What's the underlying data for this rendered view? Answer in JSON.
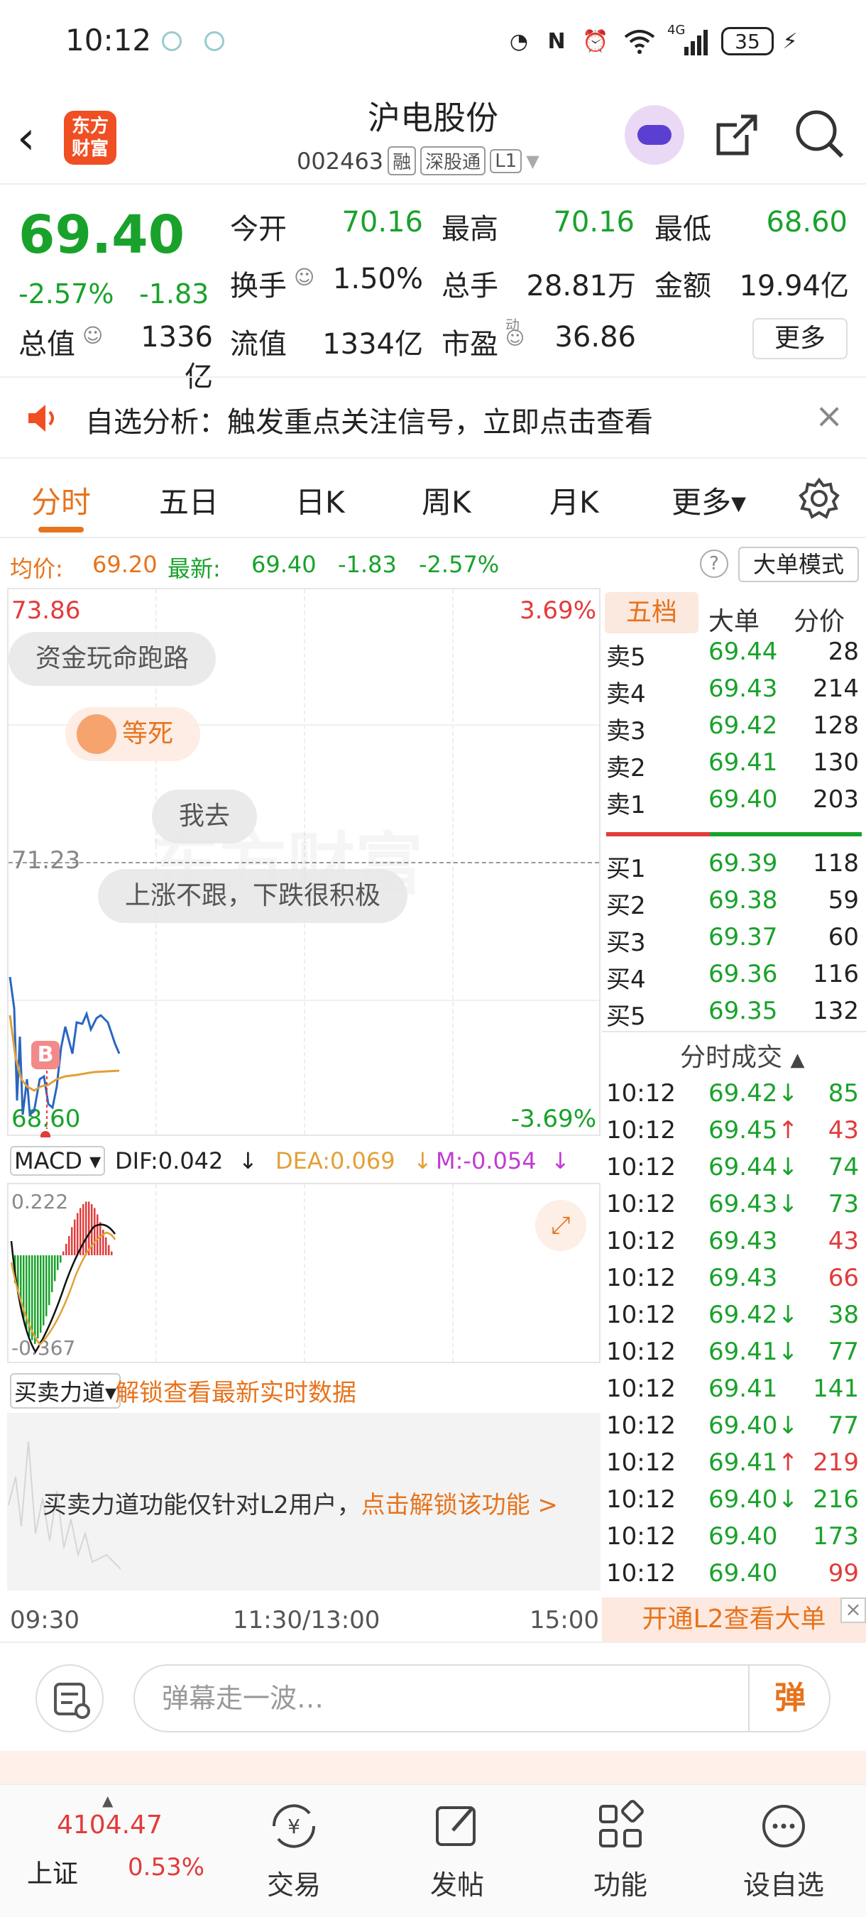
{
  "status": {
    "time": "10:12",
    "network": "4G",
    "battery": "35"
  },
  "header": {
    "logo_line1": "东方",
    "logo_line2": "财富",
    "stock_name": "沪电股份",
    "stock_code": "002463",
    "tags": [
      "融",
      "深股通",
      "L1"
    ]
  },
  "quote": {
    "price": "69.40",
    "change_pct": "-2.57%",
    "change": "-1.83",
    "open_label": "今开",
    "open": "70.16",
    "high_label": "最高",
    "high": "70.16",
    "low_label": "最低",
    "low": "68.60",
    "turnover_label": "换手",
    "turnover": "1.50%",
    "volume_label": "总手",
    "volume": "28.81万",
    "amount_label": "金额",
    "amount": "19.94亿",
    "mcap_label": "总值",
    "mcap": "1336亿",
    "float_label": "流值",
    "float": "1334亿",
    "pe_label": "市盈",
    "pe_super": "动",
    "pe": "36.86",
    "more_label": "更多"
  },
  "alert": {
    "text": "自选分析：触发重点关注信号，立即点击查看"
  },
  "tabs": [
    "分时",
    "五日",
    "日K",
    "周K",
    "月K",
    "更多▾"
  ],
  "avgbar": {
    "avg_label": "均价:",
    "avg": "69.20",
    "latest_label": "最新:",
    "latest": "69.40",
    "chg": "-1.83",
    "pct": "-2.57%",
    "big_order_label": "大单模式"
  },
  "chart": {
    "y_top": "73.86",
    "y_mid": "71.23",
    "y_bottom": "68.60",
    "pct_top": "3.69%",
    "pct_bottom": "-3.69%",
    "marker": "B",
    "danmu": [
      "资金玩命跑路",
      "等死",
      "我去",
      "上涨不跟，下跌很积极"
    ],
    "watermark": "东方财富"
  },
  "book_tabs": [
    "五档",
    "大单",
    "分价"
  ],
  "asks": [
    {
      "label": "卖5",
      "price": "69.44",
      "vol": "28"
    },
    {
      "label": "卖4",
      "price": "69.43",
      "vol": "214"
    },
    {
      "label": "卖3",
      "price": "69.42",
      "vol": "128"
    },
    {
      "label": "卖2",
      "price": "69.41",
      "vol": "130"
    },
    {
      "label": "卖1",
      "price": "69.40",
      "vol": "203"
    }
  ],
  "bids": [
    {
      "label": "买1",
      "price": "69.39",
      "vol": "118"
    },
    {
      "label": "买2",
      "price": "69.38",
      "vol": "59"
    },
    {
      "label": "买3",
      "price": "69.37",
      "vol": "60"
    },
    {
      "label": "买4",
      "price": "69.36",
      "vol": "116"
    },
    {
      "label": "买5",
      "price": "69.35",
      "vol": "132"
    }
  ],
  "ticks_title": "分时成交",
  "ticks": [
    {
      "t": "10:12",
      "p": "69.42",
      "dir": "↓",
      "v": "85",
      "vc": "green"
    },
    {
      "t": "10:12",
      "p": "69.45",
      "dir": "↑",
      "v": "43",
      "vc": "red"
    },
    {
      "t": "10:12",
      "p": "69.44",
      "dir": "↓",
      "v": "74",
      "vc": "green"
    },
    {
      "t": "10:12",
      "p": "69.43",
      "dir": "↓",
      "v": "73",
      "vc": "green"
    },
    {
      "t": "10:12",
      "p": "69.43",
      "dir": "",
      "v": "43",
      "vc": "red"
    },
    {
      "t": "10:12",
      "p": "69.43",
      "dir": "",
      "v": "66",
      "vc": "red"
    },
    {
      "t": "10:12",
      "p": "69.42",
      "dir": "↓",
      "v": "38",
      "vc": "green"
    },
    {
      "t": "10:12",
      "p": "69.41",
      "dir": "↓",
      "v": "77",
      "vc": "green"
    },
    {
      "t": "10:12",
      "p": "69.41",
      "dir": "",
      "v": "141",
      "vc": "green"
    },
    {
      "t": "10:12",
      "p": "69.40",
      "dir": "↓",
      "v": "77",
      "vc": "green"
    },
    {
      "t": "10:12",
      "p": "69.41",
      "dir": "↑",
      "v": "219",
      "vc": "red"
    },
    {
      "t": "10:12",
      "p": "69.40",
      "dir": "↓",
      "v": "216",
      "vc": "green"
    },
    {
      "t": "10:12",
      "p": "69.40",
      "dir": "",
      "v": "173",
      "vc": "green"
    },
    {
      "t": "10:12",
      "p": "69.40",
      "dir": "",
      "v": "99",
      "vc": "red"
    }
  ],
  "macd": {
    "label": "MACD ▾",
    "dif": "DIF:0.042",
    "dif_arrow": "↓",
    "dea": "DEA:0.069",
    "dea_arrow": "↓",
    "m": "M:-0.054",
    "m_arrow": "↓",
    "y_top": "0.222",
    "y_bottom": "-0.367"
  },
  "power": {
    "label": "买卖力道▾",
    "unlock": "解锁查看最新实时数据",
    "notice": "买卖力道功能仅针对L2用户，",
    "notice_link": "点击解锁该功能 >"
  },
  "time_axis": {
    "start": "09:30",
    "mid": "11:30/13:00",
    "end": "15:00"
  },
  "l2_open": "开通L2查看大单",
  "input": {
    "placeholder": "弹幕走一波…",
    "send": "弹"
  },
  "bottom": {
    "index_value": "4104.47",
    "index_name": "上证",
    "index_pct": "0.53%",
    "items": [
      "交易",
      "发帖",
      "功能",
      "设自选"
    ]
  },
  "colors": {
    "up": "#e23b3b",
    "down": "#19a22b",
    "accent": "#e7731c"
  }
}
